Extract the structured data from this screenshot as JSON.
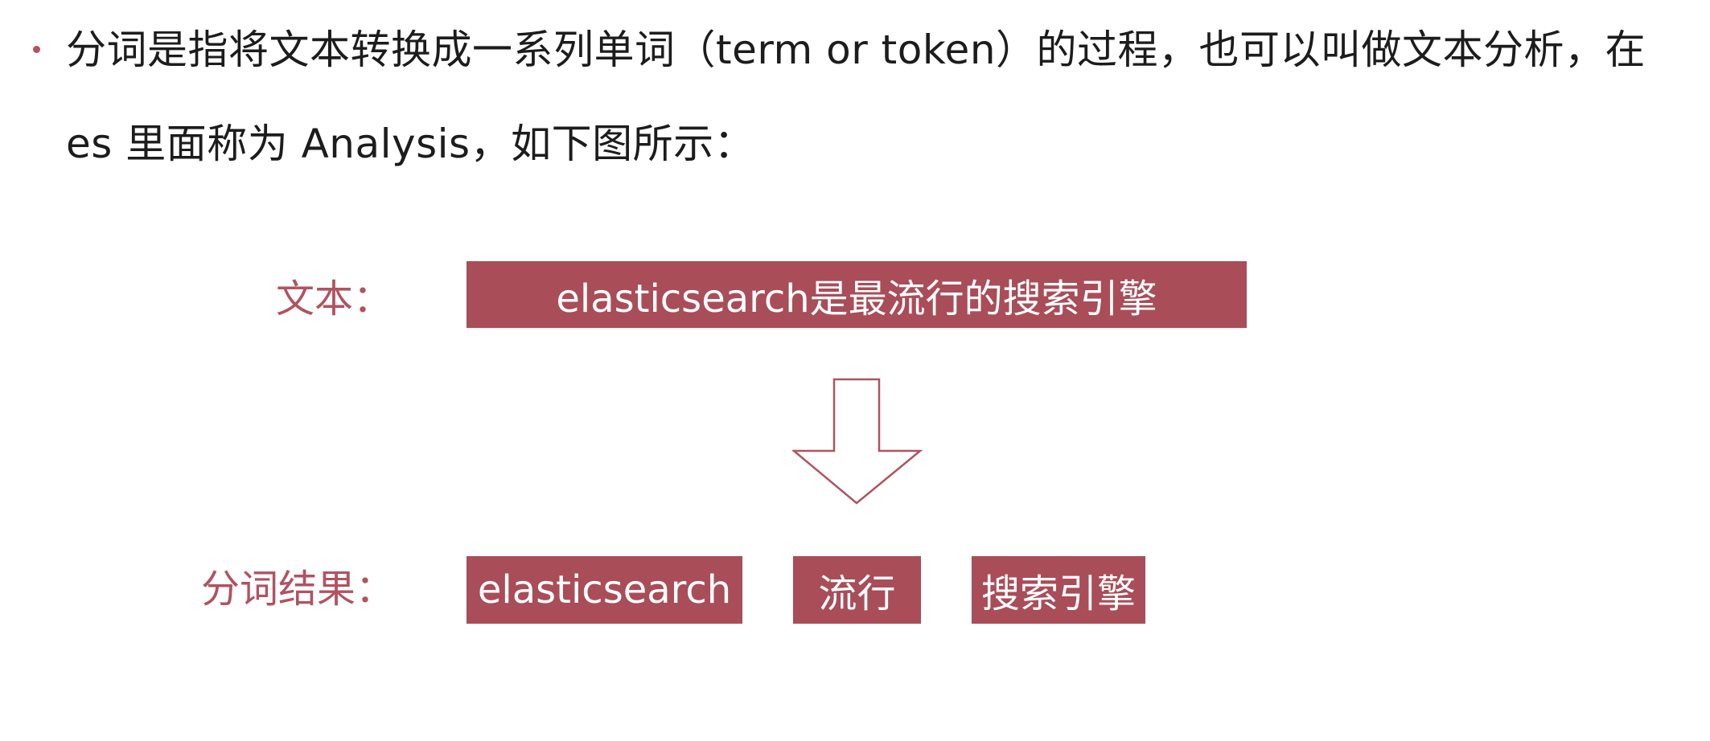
{
  "paragraph": {
    "line1": "分词是指将文本转换成一系列单词（term or token）的过程，也可以叫做文本分析，在",
    "line2": "es 里面称为 Analysis，如下图所示："
  },
  "diagram": {
    "text_label": "文本：",
    "source_text": "elasticsearch是最流行的搜索引擎",
    "result_label": "分词结果：",
    "tokens": [
      "elasticsearch",
      "流行",
      "搜索引擎"
    ]
  },
  "colors": {
    "accent": "#a94d59",
    "label": "#b05361",
    "bullet": "#b7515e",
    "arrow_stroke": "#b05361"
  },
  "icons": {
    "flow_arrow": "down-arrow-icon"
  }
}
